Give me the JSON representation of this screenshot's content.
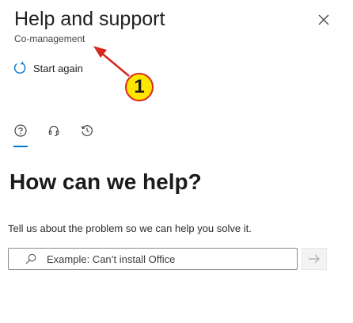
{
  "panel": {
    "title": "Help and support",
    "subtitle": "Co-management",
    "close_icon": "close-icon"
  },
  "start_again": {
    "label": "Start again",
    "icon": "refresh-icon"
  },
  "tabs": [
    {
      "icon": "help-question-icon",
      "active": true
    },
    {
      "icon": "headset-icon",
      "active": false
    },
    {
      "icon": "history-icon",
      "active": false
    }
  ],
  "main": {
    "heading": "How can we help?",
    "description": "Tell us about the problem so we can help you solve it.",
    "search": {
      "value": "",
      "placeholder": "Example: Can’t install Office",
      "icon": "search-icon",
      "submit_icon": "arrow-right-icon"
    }
  },
  "annotation": {
    "label": "1",
    "colors": {
      "fill": "#ffe600",
      "stroke": "#d7261e"
    }
  },
  "colors": {
    "accent": "#0078d4"
  }
}
